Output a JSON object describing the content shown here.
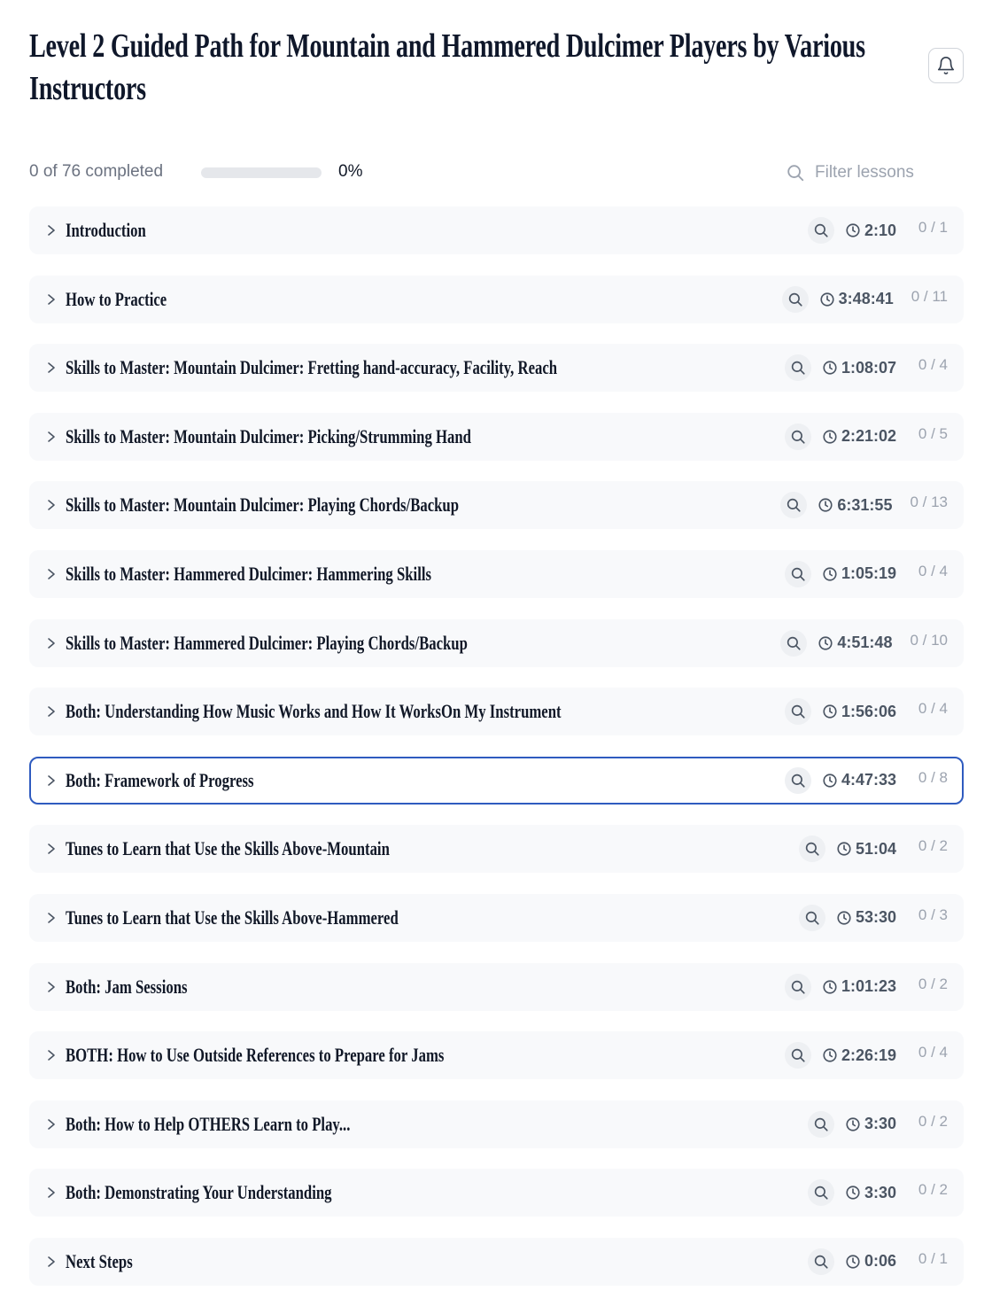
{
  "page": {
    "title": "Level 2 Guided Path for Mountain and Hammered Dulcimer Players by Various Instructors"
  },
  "progress": {
    "completed_label": "0 of 76 completed",
    "percent_label": "0%",
    "percent_value": 0
  },
  "filter": {
    "placeholder": "Filter lessons"
  },
  "sections": [
    {
      "title": "Introduction",
      "duration": "2:10",
      "count": "0 / 1"
    },
    {
      "title": "How to Practice",
      "duration": "3:48:41",
      "count": "0 / 11"
    },
    {
      "title": "Skills to Master: Mountain Dulcimer: Fretting hand-accuracy, Facility, Reach",
      "duration": "1:08:07",
      "count": "0 / 4"
    },
    {
      "title": "Skills to Master: Mountain Dulcimer: Picking/Strumming Hand",
      "duration": "2:21:02",
      "count": "0 / 5"
    },
    {
      "title": "Skills to Master: Mountain Dulcimer: Playing Chords/Backup",
      "duration": "6:31:55",
      "count": "0 / 13"
    },
    {
      "title": "Skills to Master: Hammered Dulcimer: Hammering Skills",
      "duration": "1:05:19",
      "count": "0 / 4"
    },
    {
      "title": "Skills to Master: Hammered Dulcimer: Playing Chords/Backup",
      "duration": "4:51:48",
      "count": "0 / 10"
    },
    {
      "title": "Both: Understanding How Music Works and How It WorksOn My Instrument",
      "duration": "1:56:06",
      "count": "0 / 4"
    },
    {
      "title": "Both: Framework of Progress",
      "duration": "4:47:33",
      "count": "0 / 8",
      "active": true
    },
    {
      "title": "Tunes to Learn that Use the Skills Above-Mountain",
      "duration": "51:04",
      "count": "0 / 2"
    },
    {
      "title": "Tunes to Learn that Use the Skills Above-Hammered",
      "duration": "53:30",
      "count": "0 / 3"
    },
    {
      "title": "Both: Jam Sessions",
      "duration": "1:01:23",
      "count": "0 / 2"
    },
    {
      "title": "BOTH: How to Use Outside References to Prepare for Jams",
      "duration": "2:26:19",
      "count": "0 / 4"
    },
    {
      "title": "Both: How to Help OTHERS Learn to Play...",
      "duration": "3:30",
      "count": "0 / 2"
    },
    {
      "title": "Both: Demonstrating Your Understanding",
      "duration": "3:30",
      "count": "0 / 2"
    },
    {
      "title": "Next Steps",
      "duration": "0:06",
      "count": "0 / 1"
    }
  ],
  "icons": {
    "bell": "bell-icon",
    "search": "search-icon",
    "chevron": "chevron-right-icon",
    "clock": "clock-icon"
  },
  "colors": {
    "accent": "#2f5bbf",
    "row_bg": "#f8f9fb",
    "muted": "#9ca3af"
  }
}
